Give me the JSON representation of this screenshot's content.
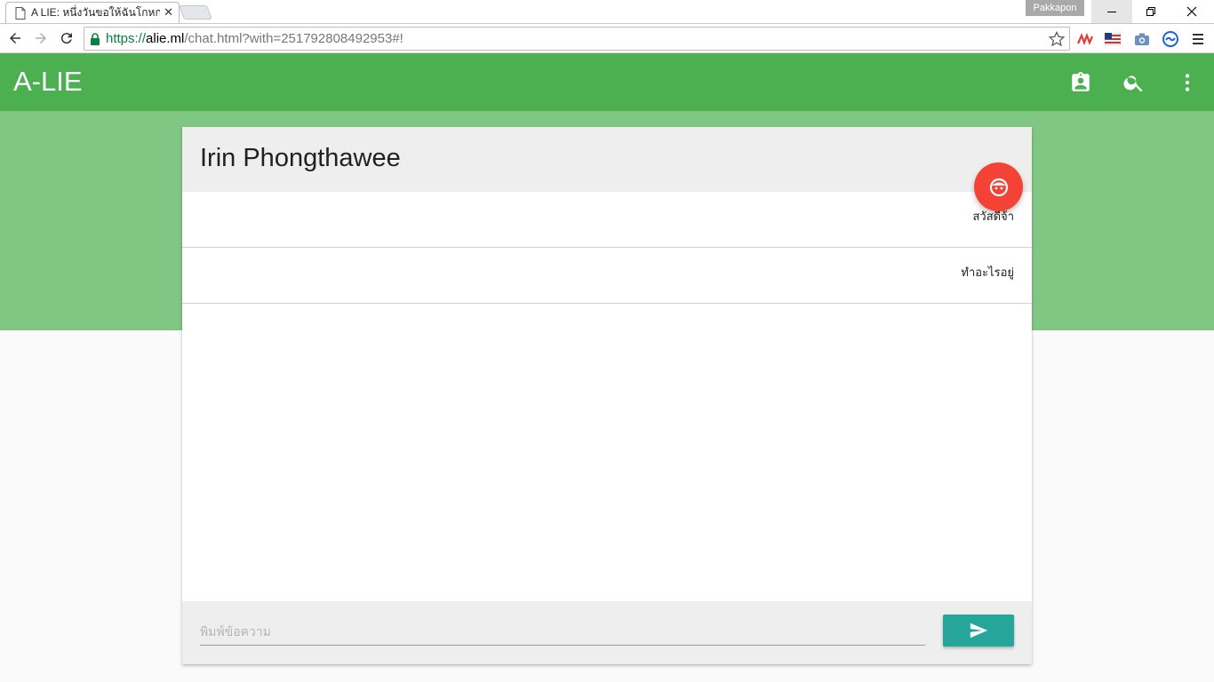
{
  "browser": {
    "tab_title": "A LIE: หนึ่งวันขอให้ฉันโกหกเธอ",
    "profile_name": "Pakkapon",
    "url_scheme": "https://",
    "url_host": "alie.ml",
    "url_path": "/chat.html?with=251792808492953#!",
    "icons": {
      "page": "page-icon",
      "close": "close-icon",
      "back": "back-arrow-icon",
      "forward": "forward-arrow-icon",
      "reload": "reload-icon",
      "lock": "lock-icon",
      "bookmark": "star-icon",
      "minimize": "minimize-icon",
      "restore": "restore-icon",
      "window_close": "close-icon"
    }
  },
  "appbar": {
    "title": "A-LIE",
    "color": "#4caf50",
    "icons": [
      "contact-card-icon",
      "search-icon",
      "more-vert-icon"
    ]
  },
  "chat": {
    "contact_name": "Irin Phongthawee",
    "fab_icon": "face-icon",
    "fab_color": "#f44336",
    "messages": [
      {
        "text": "สวัสดีจ้า"
      },
      {
        "text": "ทำอะไรอยู่"
      }
    ],
    "compose": {
      "value": "",
      "placeholder": "พิมพ์ข้อความ",
      "send_icon": "send-icon",
      "send_color": "#26a69a"
    }
  }
}
